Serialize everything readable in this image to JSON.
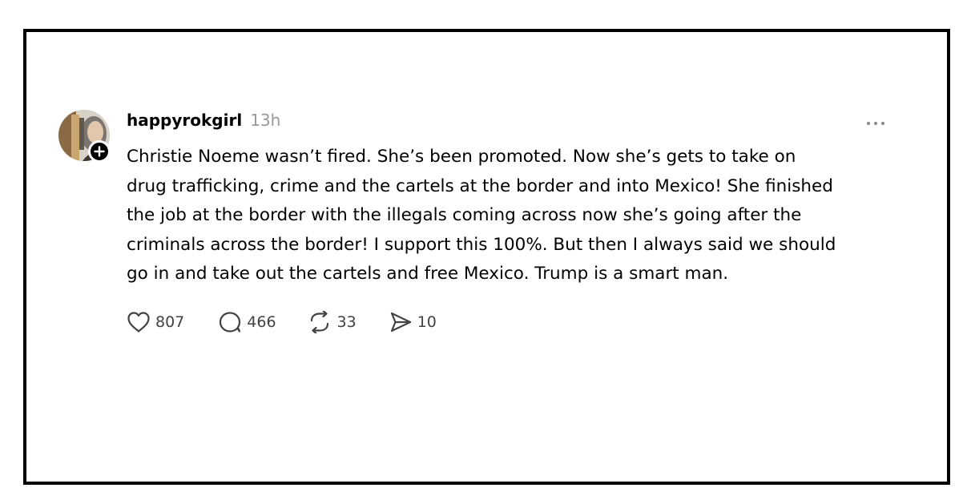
{
  "post": {
    "username": "happyrokgirl",
    "timestamp": "13h",
    "text": "Christie Noeme wasn’t fired. She’s been promoted. Now she’s gets to take on\ndrug trafficking, crime and the cartels at the border and into Mexico! She finished\nthe job at the border with the illegals coming across now she’s going after the\ncriminals across the border! I support this 100%. But then I always said we should\ngo in and take out the cartels and free Mexico. Trump is a smart man.",
    "more_icon": "more-horizontal-icon",
    "follow_icon": "plus-icon"
  },
  "actions": {
    "likes": "807",
    "replies": "466",
    "reposts": "33",
    "shares": "10",
    "like_icon": "heart-icon",
    "reply_icon": "comment-bubble-icon",
    "repost_icon": "repost-icon",
    "share_icon": "send-icon"
  },
  "colors": {
    "frame_border": "#000000",
    "username": "#000000",
    "timestamp": "#999999",
    "text": "#000000",
    "action_icon": "#424242"
  }
}
